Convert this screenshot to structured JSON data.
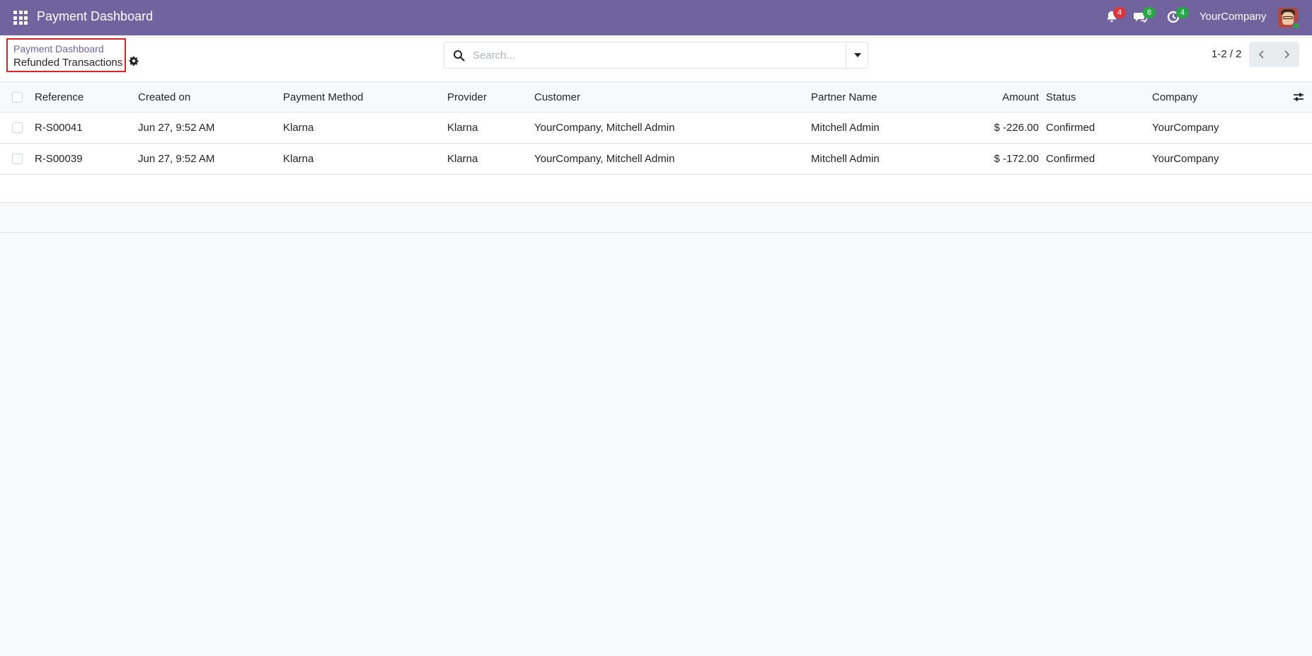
{
  "navbar": {
    "app_title": "Payment Dashboard",
    "notifications": {
      "icon": "bell-icon",
      "count": "4"
    },
    "messages": {
      "icon": "chat-icon",
      "count": "8"
    },
    "activities": {
      "icon": "clock-icon",
      "count": "4"
    },
    "company": "YourCompany",
    "avatar": "user-avatar"
  },
  "breadcrumb": {
    "parent": "Payment Dashboard",
    "current": "Refunded Transactions"
  },
  "search": {
    "placeholder": "Search..."
  },
  "pager": {
    "value": "1-2 / 2"
  },
  "table": {
    "columns": [
      "Reference",
      "Created on",
      "Payment Method",
      "Provider",
      "Customer",
      "Partner Name",
      "Amount",
      "Status",
      "Company"
    ],
    "rows": [
      [
        "R-S00041",
        "Jun 27, 9:52 AM",
        "Klarna",
        "Klarna",
        "YourCompany, Mitchell Admin",
        "Mitchell Admin",
        "$ -226.00",
        "Confirmed",
        "YourCompany"
      ],
      [
        "R-S00039",
        "Jun 27, 9:52 AM",
        "Klarna",
        "Klarna",
        "YourCompany, Mitchell Admin",
        "Mitchell Admin",
        "$ -172.00",
        "Confirmed",
        "YourCompany"
      ]
    ]
  },
  "colors": {
    "brand": "#71639e",
    "badge_red": "#d9363e",
    "badge_green": "#28a745",
    "highlight_border": "#e0202a"
  }
}
